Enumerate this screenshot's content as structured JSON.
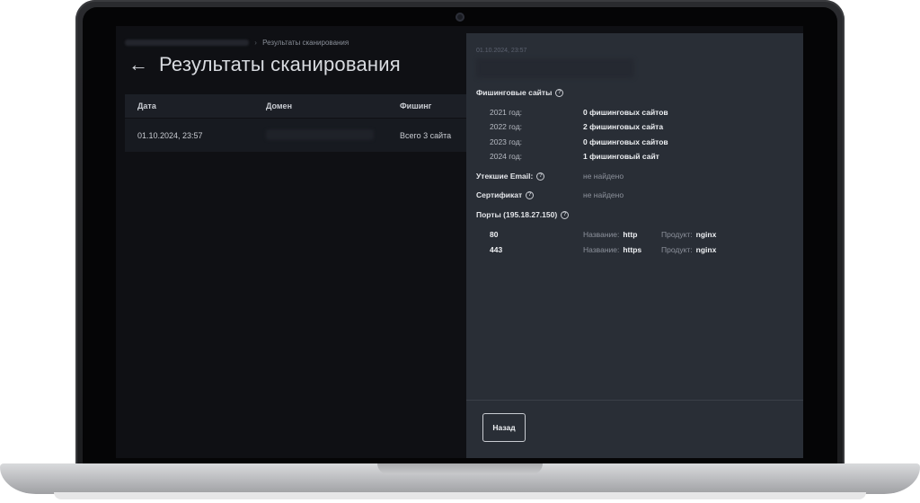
{
  "breadcrumb": {
    "current": "Результаты сканирования"
  },
  "page": {
    "title": "Результаты сканирования"
  },
  "table": {
    "headers": [
      "Дата",
      "Домен",
      "Фишинг"
    ],
    "rows": [
      {
        "date": "01.10.2024, 23:57",
        "phishing": "Всего 3 сайта"
      }
    ]
  },
  "details": {
    "date": "01.10.2024, 23:57",
    "phishing_title": "Фишинговые сайты",
    "years": [
      {
        "year": "2021 год:",
        "value": "0 фишинговых сайтов"
      },
      {
        "year": "2022 год:",
        "value": "2 фишинговых сайта"
      },
      {
        "year": "2023 год:",
        "value": "0 фишинговых сайтов"
      },
      {
        "year": "2024 год:",
        "value": "1 фишинговый сайт"
      }
    ],
    "emails_label": "Утекшие Email:",
    "emails_value": "не найдено",
    "cert_label": "Сертификат",
    "cert_value": "не найдено",
    "ports_title": "Порты (195.18.27.150)",
    "ports": [
      {
        "port": "80",
        "name_label": "Название:",
        "name": "http",
        "product_label": "Продукт:",
        "product": "nginx"
      },
      {
        "port": "443",
        "name_label": "Название:",
        "name": "https",
        "product_label": "Продукт:",
        "product": "nginx"
      }
    ],
    "back_button": "Назад"
  },
  "icons": {
    "back": "arrow-left-icon",
    "help": "question-circle-icon"
  },
  "colors": {
    "panel": "#292e36",
    "background": "#0f1014",
    "text": "#eef0f3"
  }
}
